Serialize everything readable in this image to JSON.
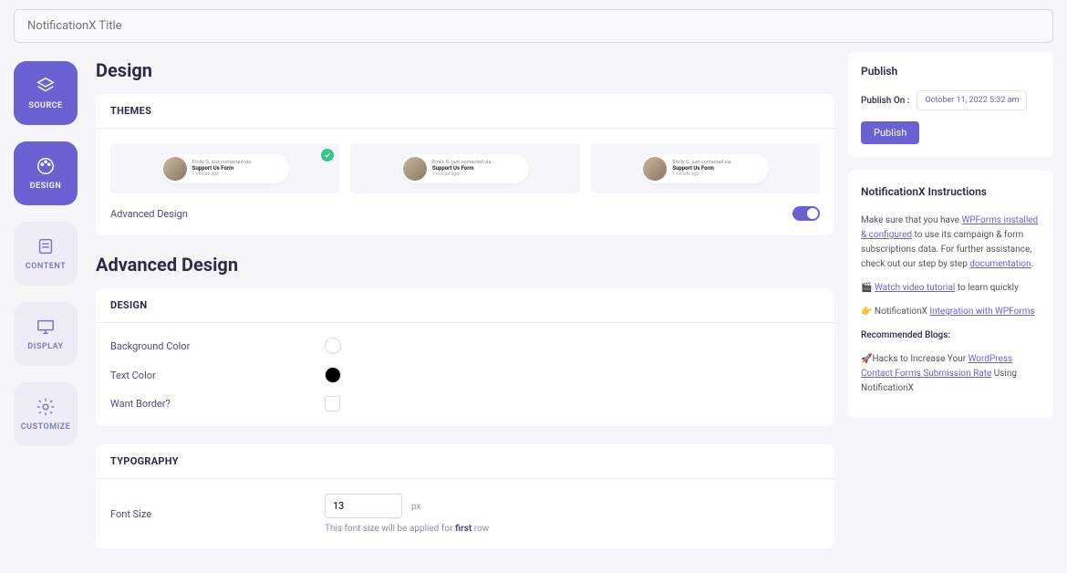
{
  "title_placeholder": "NotificationX Title",
  "steps": {
    "source": "SOURCE",
    "design": "DESIGN",
    "content": "CONTENT",
    "display": "DISPLAY",
    "customize": "CUSTOMIZE"
  },
  "design": {
    "heading": "Design",
    "themes_label": "THEMES",
    "advanced_design_label": "Advanced Design",
    "theme_preview": {
      "line1": "Emily G. just contacted via",
      "line2": "Support Us Form",
      "line3": "1 minute ago"
    }
  },
  "advanced": {
    "heading": "Advanced Design",
    "design_section": "DESIGN",
    "bg_color": "Background Color",
    "text_color": "Text Color",
    "want_border": "Want Border?",
    "typography_section": "TYPOGRAPHY",
    "font_size": "Font Size",
    "font_size_value": "13",
    "font_size_unit": "px",
    "font_hint_pre": "This font size will be applied for ",
    "font_hint_bold": "first",
    "font_hint_post": " row"
  },
  "publish": {
    "title": "Publish",
    "on_label": "Publish On :",
    "date": "October 11, 2022 5:32 am",
    "button": "Publish"
  },
  "instructions": {
    "title": "NotificationX Instructions",
    "p1_pre": "Make sure that you have ",
    "p1_link": "WPForms installed & configured",
    "p1_mid": " to use its campaign & form subscriptions data. For further assistance, check out our step by step ",
    "p1_link2": "documentation",
    "p1_post": ".",
    "p2_icon": "🎬",
    "p2_link": "Watch video tutorial",
    "p2_post": " to learn quickly",
    "p3_icon": "👉",
    "p3_pre": " NotificationX ",
    "p3_link": "Integration with WPForms",
    "p4": "Recommended Blogs:",
    "p5_icon": "🚀",
    "p5_pre": "Hacks to Increase Your ",
    "p5_link": "WordPress Contact Forms Submission Rate",
    "p5_post": " Using NotificationX"
  }
}
